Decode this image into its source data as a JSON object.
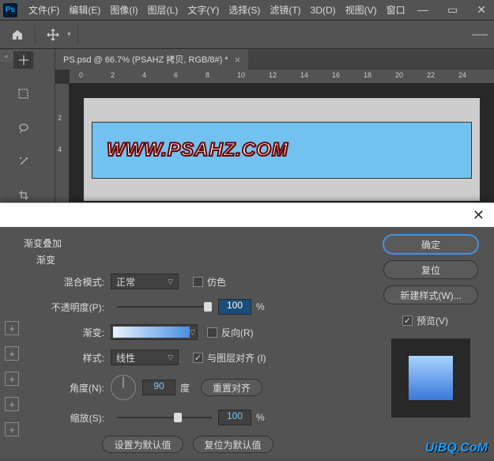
{
  "app": {
    "logo": "Ps"
  },
  "menus": [
    "文件(F)",
    "编辑(E)",
    "图像(I)",
    "图层(L)",
    "文字(Y)",
    "选择(S)",
    "滤镜(T)",
    "3D(D)",
    "视图(V)",
    "窗口"
  ],
  "win": {
    "min": "—",
    "max": "▭",
    "close": "✕"
  },
  "tab": {
    "title": "PS.psd @ 66.7% (PSAHZ 拷贝, RGB/8#) *",
    "close": "×"
  },
  "ruler_h": [
    "0",
    "2",
    "4",
    "6",
    "8",
    "10",
    "12",
    "14",
    "16",
    "18",
    "20",
    "22",
    "24"
  ],
  "ruler_v": [
    "2",
    "4"
  ],
  "banner": "WWW.PSAHZ.COM",
  "dialog": {
    "title": "渐变叠加",
    "subtitle": "渐变",
    "labels": {
      "blend": "混合模式:",
      "opacity": "不透明度(P):",
      "gradient": "渐变:",
      "style": "样式:",
      "angle": "角度(N):",
      "scale": "缩放(S):"
    },
    "values": {
      "blend": "正常",
      "opacity": "100",
      "style": "线性",
      "angle": "90",
      "scale": "100"
    },
    "checks": {
      "dither": "仿色",
      "reverse": "反向(R)",
      "align": "与图层对齐 (I)",
      "preview": "预览(V)"
    },
    "units": {
      "pct": "%",
      "deg": "度"
    },
    "buttons": {
      "ok": "确定",
      "cancel": "复位",
      "newstyle": "新建样式(W)...",
      "resetalign": "重置对齐",
      "setdefault": "设置为默认值",
      "resetdefault": "复位为默认值"
    }
  },
  "watermark": "UiBQ.CoM"
}
